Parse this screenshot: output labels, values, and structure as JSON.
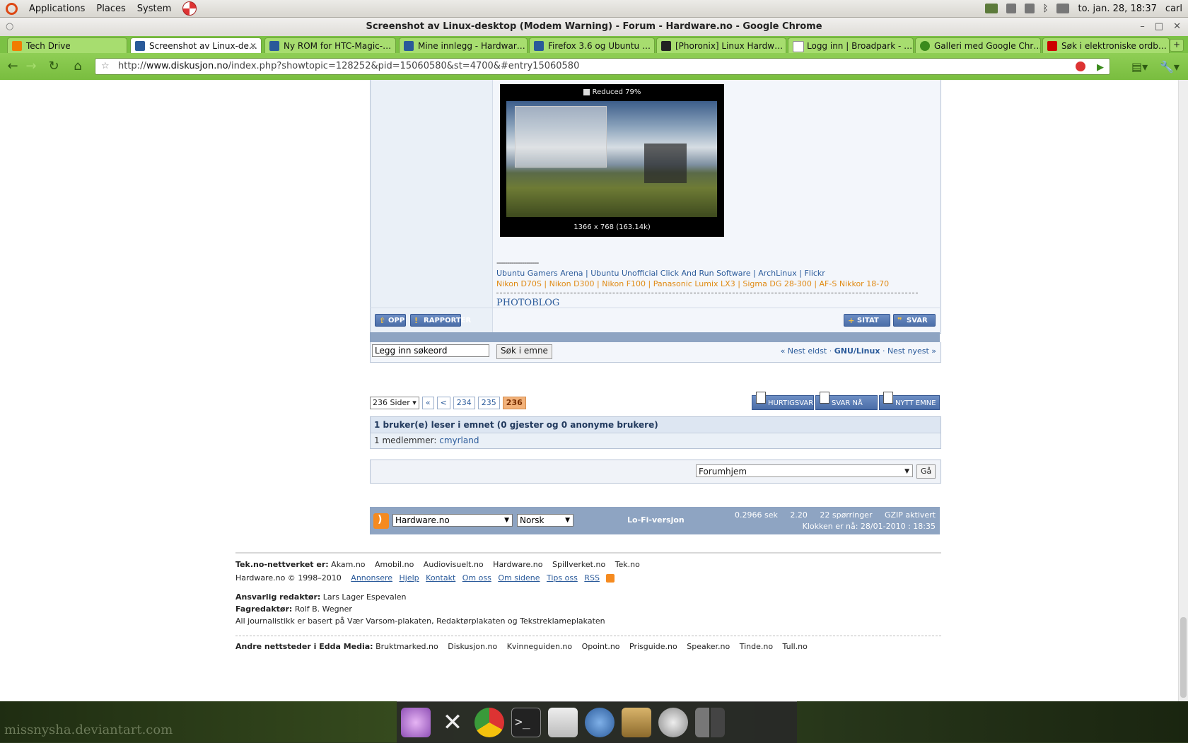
{
  "panel": {
    "menus": [
      "Applications",
      "Places",
      "System"
    ],
    "clock": "to. jan. 28, 18:37",
    "user": "carl"
  },
  "window": {
    "title": "Screenshot av Linux-desktop (Modem Warning) - Forum - Hardware.no - Google Chrome"
  },
  "tabs": [
    {
      "label": "Tech Drive"
    },
    {
      "label": "Screenshot av Linux-de…"
    },
    {
      "label": "Ny ROM for HTC-Magic-…"
    },
    {
      "label": "Mine innlegg - Hardwar…"
    },
    {
      "label": "Firefox 3.6 og Ubuntu …"
    },
    {
      "label": "[Phoronix] Linux Hardw…"
    },
    {
      "label": "Logg inn | Broadpark - …"
    },
    {
      "label": "Galleri med Google Chr…"
    },
    {
      "label": "Søk i elektroniske ordb…"
    }
  ],
  "omnibox": {
    "prefix": "http://",
    "domain": "www.diskusjon.no",
    "path": "/index.php?showtopic=128252&pid=15060580&st=4700&#entry15060580"
  },
  "post": {
    "thumb_reduced": "Reduced 79%",
    "thumb_dims": "1366 x 768 (163.14k)",
    "sig_dash": "--------------------",
    "sig_links": [
      "Ubuntu Gamers Arena",
      "Ubuntu Unofficial Click And Run Software",
      "ArchLinux",
      "Flickr"
    ],
    "sig_gear": "Nikon D70S | Nikon D300 | Nikon F100 | Panasonic Lumix LX3 | Sigma DG 28-300 | AF-S Nikkor 18-70",
    "photoblog": "PHOTOBLOG",
    "btn_up": "OPP",
    "btn_report": "RAPPORTER",
    "btn_quote": "SITAT",
    "btn_reply": "SVAR"
  },
  "search": {
    "placeholder": "Legg inn søkeord",
    "button": "Søk i emne",
    "prev": "« Nest eldst",
    "sep1": "·",
    "forum": "GNU/Linux",
    "sep2": "·",
    "next": "Nest nyest »"
  },
  "pager": {
    "pages_label": "236 Sider",
    "first": "«",
    "prev": "<",
    "p1": "234",
    "p2": "235",
    "current": "236"
  },
  "action_buttons": {
    "quick": "HURTIGSVAR",
    "reply_now": "SVAR NÅ",
    "new_topic": "NYTT EMNE"
  },
  "readers": {
    "header": "1 bruker(e) leser i emnet (0 gjester og 0 anonyme brukere)",
    "members_label": "1 medlemmer:",
    "member": "cmyrland"
  },
  "jump": {
    "selected": "Forumhjem",
    "go": "Gå"
  },
  "footer": {
    "site_select": "Hardware.no",
    "lang_select": "Norsk",
    "lofi": "Lo-Fi-versjon",
    "time": "0.2966 sek",
    "load": "2.20",
    "queries": "22 spørringer",
    "gzip": "GZIP aktivert",
    "clock": "Klokken er nå: 28/01-2010 : 18:35"
  },
  "sitefoot": {
    "network_label": "Tek.no-nettverket er:",
    "network": [
      "Akam.no",
      "Amobil.no",
      "Audiovisuelt.no",
      "Hardware.no",
      "Spillverket.no",
      "Tek.no"
    ],
    "copyright": "Hardware.no © 1998–2010",
    "links": [
      "Annonsere",
      "Hjelp",
      "Kontakt",
      "Om oss",
      "Om sidene",
      "Tips oss",
      "RSS"
    ],
    "editor_label": "Ansvarlig redaktør:",
    "editor": "Lars Lager Espevalen",
    "feditor_label": "Fagredaktør:",
    "feditor": "Rolf B. Wegner",
    "ethics": "All journalistikk er basert på Vær Varsom-plakaten, Redaktørplakaten og Tekstreklameplakaten",
    "edda_label": "Andre nettsteder i Edda Media:",
    "edda": [
      "Bruktmarked.no",
      "Diskusjon.no",
      "Kvinneguiden.no",
      "Opoint.no",
      "Prisguide.no",
      "Speaker.no",
      "Tinde.no",
      "Tull.no"
    ]
  },
  "desktop": {
    "watermark": "missnysha.deviantart.com"
  },
  "dock": [
    "settings-icon",
    "close-icon",
    "chrome-icon",
    "terminal-icon",
    "mail-icon",
    "pidgin-icon",
    "home-icon",
    "clock-icon",
    "workspace-icon"
  ]
}
